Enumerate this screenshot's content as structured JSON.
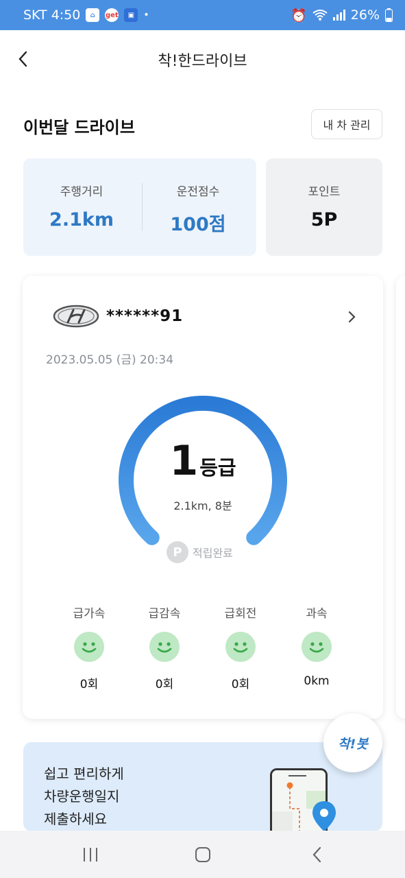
{
  "status_bar": {
    "carrier_time": "SKT 4:50",
    "get_badge": "get",
    "battery": "26%"
  },
  "header": {
    "title": "착!한드라이브"
  },
  "summary": {
    "section_title": "이번달 드라이브",
    "car_manage_label": "내 차 관리",
    "distance_label": "주행거리",
    "distance_value": "2.1km",
    "score_label": "운전점수",
    "score_value": "100점",
    "points_label": "포인트",
    "points_value": "5P"
  },
  "drive_card": {
    "plate": "******91",
    "date": "2023.05.05 (금) 20:34",
    "grade_number": "1",
    "grade_unit": "등급",
    "summary": "2.1km, 8분",
    "point_badge": "P",
    "point_status": "적립완료",
    "metrics": [
      {
        "label": "급가속",
        "value": "0회"
      },
      {
        "label": "급감속",
        "value": "0회"
      },
      {
        "label": "급회전",
        "value": "0회"
      },
      {
        "label": "과속",
        "value": "0km"
      }
    ]
  },
  "promo": {
    "lines": [
      "쉽고 편리하게",
      "차량운행일지",
      "제출하세요"
    ]
  },
  "fab": {
    "label": "착!봇"
  },
  "colors": {
    "accent": "#2e79c4",
    "status_bar": "#4a90e2",
    "smiley": "#5cc46a",
    "smiley_bg": "#bfe8c4"
  }
}
